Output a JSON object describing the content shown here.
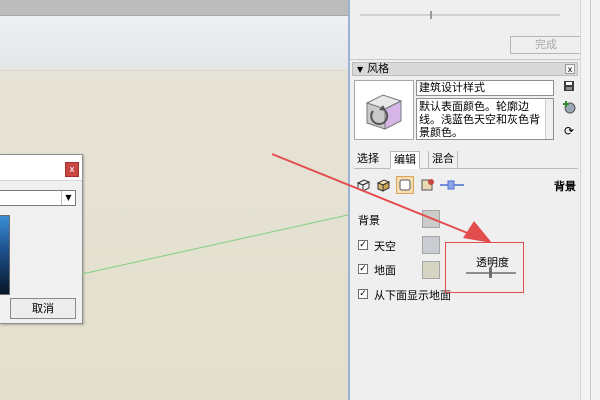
{
  "viewport": {
    "dialog": {
      "close_label": "x",
      "cancel_label": "取消"
    }
  },
  "panel": {
    "done_label": "完成",
    "style_panel": {
      "title": "风格",
      "close_label": "x",
      "style_name": "建筑设计样式",
      "description": "默认表面颜色。轮廓边线。浅蓝色天空和灰色背景颜色。"
    },
    "tabs": [
      {
        "label": "选择"
      },
      {
        "label": "编辑"
      },
      {
        "label": "混合"
      }
    ],
    "section_title": "背景",
    "background": {
      "label": "背景",
      "color": "#cbccc7"
    },
    "sky": {
      "label": "天空",
      "checked": true,
      "color": "#c9cdd1"
    },
    "ground": {
      "label": "地面",
      "checked": true,
      "color": "#d6d4c2"
    },
    "show_ground_from_below": {
      "label": "从下面显示地面",
      "checked": true
    },
    "transparency": {
      "label": "透明度",
      "value_fraction": 0.5
    }
  },
  "colors": {
    "annotation": "#e24d4d",
    "panel_accent": "#9ab3d0",
    "axis_green": "#7fcf7f"
  }
}
